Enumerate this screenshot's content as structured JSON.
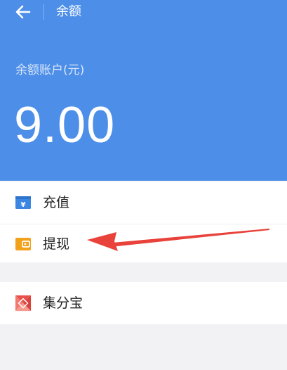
{
  "header": {
    "title": "余额",
    "back_icon": "arrow-left-icon"
  },
  "balance": {
    "label": "余额账户(元)",
    "amount": "9.00"
  },
  "menu": {
    "items": [
      {
        "label": "充值",
        "icon": "yuan-card-icon",
        "icon_color": "#3a86e0"
      },
      {
        "label": "提现",
        "icon": "wallet-icon",
        "icon_color": "#f2a11a"
      },
      {
        "label": "集分宝",
        "icon": "jifenbao-icon",
        "icon_color": "#e8504a"
      }
    ]
  },
  "colors": {
    "hero_background": "#4d8ee8",
    "page_background": "#f2f2f4",
    "annotation_arrow": "#e8423a"
  }
}
